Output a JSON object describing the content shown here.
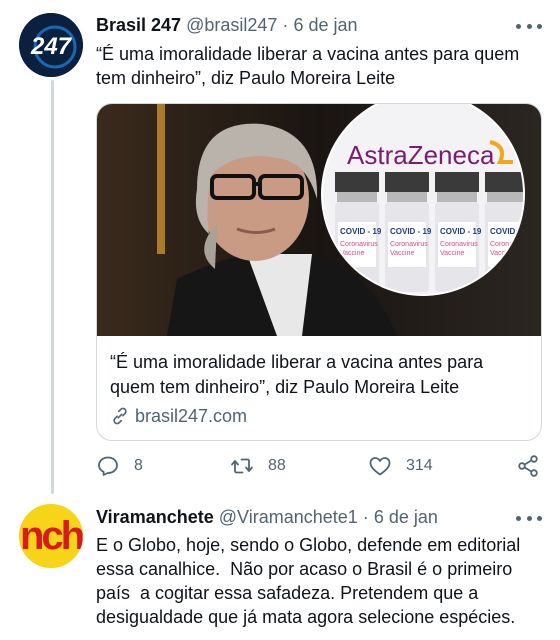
{
  "tweets": [
    {
      "avatar_text": "247",
      "name": "Brasil 247",
      "handle": "@brasil247",
      "separator": "·",
      "date": "6 de jan",
      "text": "“É uma imoralidade liberar a vacina antes para quem tem dinheiro”, diz Paulo Moreira Leite",
      "card": {
        "image_brand": "AstraZeneca",
        "vial_label": "COVID - 19",
        "vial_sub1": "Coronavirus",
        "vial_sub2": "Vaccine",
        "title": "“É uma imoralidade liberar a vacina antes para quem tem dinheiro”, diz Paulo Moreira Leite",
        "domain": "brasil247.com"
      },
      "stats": {
        "replies": "8",
        "retweets": "88",
        "likes": "314"
      }
    },
    {
      "avatar_text": "nch",
      "name": "Viramanchete",
      "handle": "@Viramanchete1",
      "separator": "·",
      "date": "6 de jan",
      "text": "E o Globo, hoje, sendo o Globo, defende em editorial essa canalhice.  Não por acaso o Brasil é o primeiro país  a cogitar essa safadeza. Pretendem que a desigualdade que já mata agora selecione espécies."
    }
  ],
  "colors": {
    "text_primary": "#0f1419",
    "text_secondary": "#536471",
    "border": "#cfd9de",
    "avatar1_bg": "#0b1f3f",
    "avatar2_bg": "#f7d417",
    "avatar2_text": "#d91a1a"
  }
}
